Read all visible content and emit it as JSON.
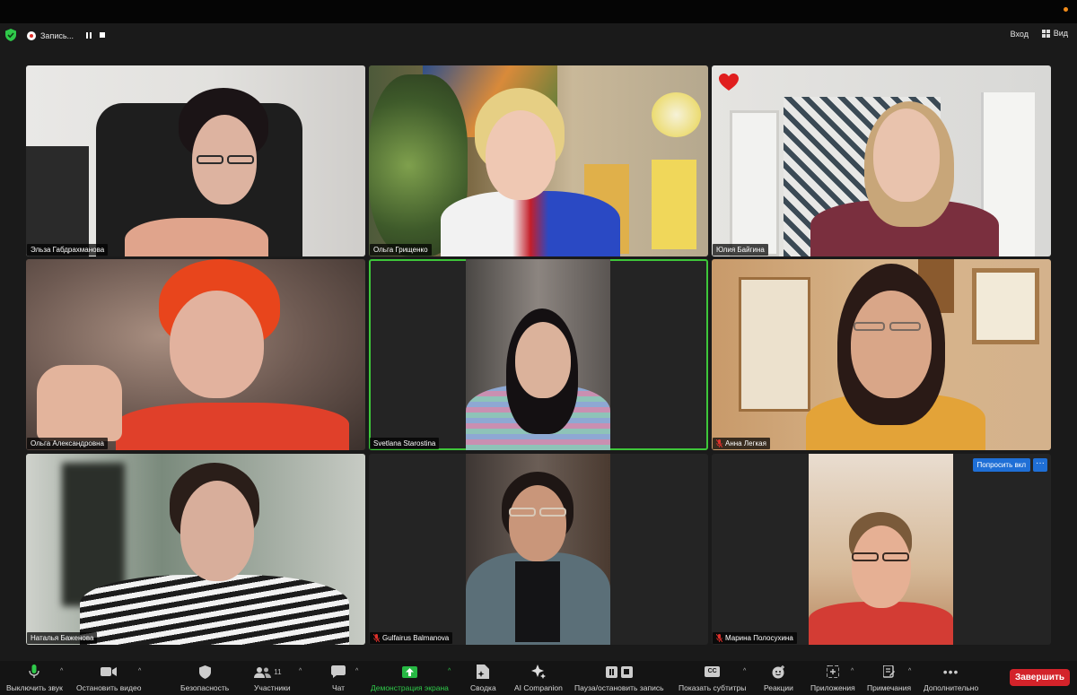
{
  "status": {
    "recording_label": "Запись...",
    "enter_label": "Вход",
    "view_label": "Вид"
  },
  "participants": [
    {
      "name": "Эльза Габдрахманова",
      "muted": false
    },
    {
      "name": "Ольга Грищенко",
      "muted": false
    },
    {
      "name": "Юлия Байгина",
      "muted": false
    },
    {
      "name": "Ольга Александровна",
      "muted": false
    },
    {
      "name": "Svetlana Starostina",
      "muted": false,
      "active_speaker": true
    },
    {
      "name": "Анна Легкая",
      "muted": true
    },
    {
      "name": "Наталья Баженова",
      "muted": false
    },
    {
      "name": "Gulfairus Balmanova",
      "muted": true
    },
    {
      "name": "Марина Полосухина",
      "muted": true
    }
  ],
  "tile_actions": {
    "ask_label": "Попросить вкл",
    "more_label": "···"
  },
  "toolbar": {
    "mute_label": "Выключить звук",
    "video_label": "Остановить видео",
    "security_label": "Безопасность",
    "participants_label": "Участники",
    "participants_count": "11",
    "chat_label": "Чат",
    "share_label": "Демонстрация экрана",
    "summary_label": "Сводка",
    "companion_label": "AI Companion",
    "pause_record_label": "Пауза/остановить запись",
    "captions_label": "Показать субтитры",
    "reactions_label": "Реакции",
    "apps_label": "Приложения",
    "notes_label": "Примечания",
    "more_label": "Дополнительно",
    "end_label": "Завершить"
  },
  "colors": {
    "active_speaker_border": "#3ec63a",
    "share_green": "#27b844",
    "end_red": "#d3232a",
    "ask_blue": "#1f6fd6",
    "recording_red": "#e0302b"
  }
}
